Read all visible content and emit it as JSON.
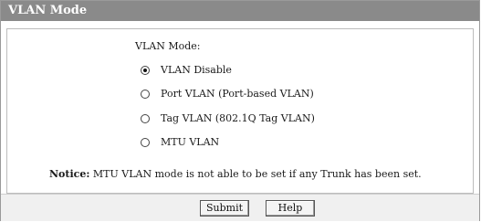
{
  "title": "VLAN Mode",
  "mode_label": "VLAN Mode:",
  "options": [
    {
      "label": "VLAN Disable",
      "checked": true
    },
    {
      "label": "Port VLAN  (Port-based VLAN)",
      "checked": false
    },
    {
      "label": "Tag VLAN  (802.1Q Tag VLAN)",
      "checked": false
    },
    {
      "label": "MTU VLAN",
      "checked": false
    }
  ],
  "notice": {
    "heading": "Notice:",
    "text": "MTU VLAN mode is not able to be set if any Trunk has been set."
  },
  "buttons": {
    "submit": "Submit",
    "help": "Help"
  }
}
